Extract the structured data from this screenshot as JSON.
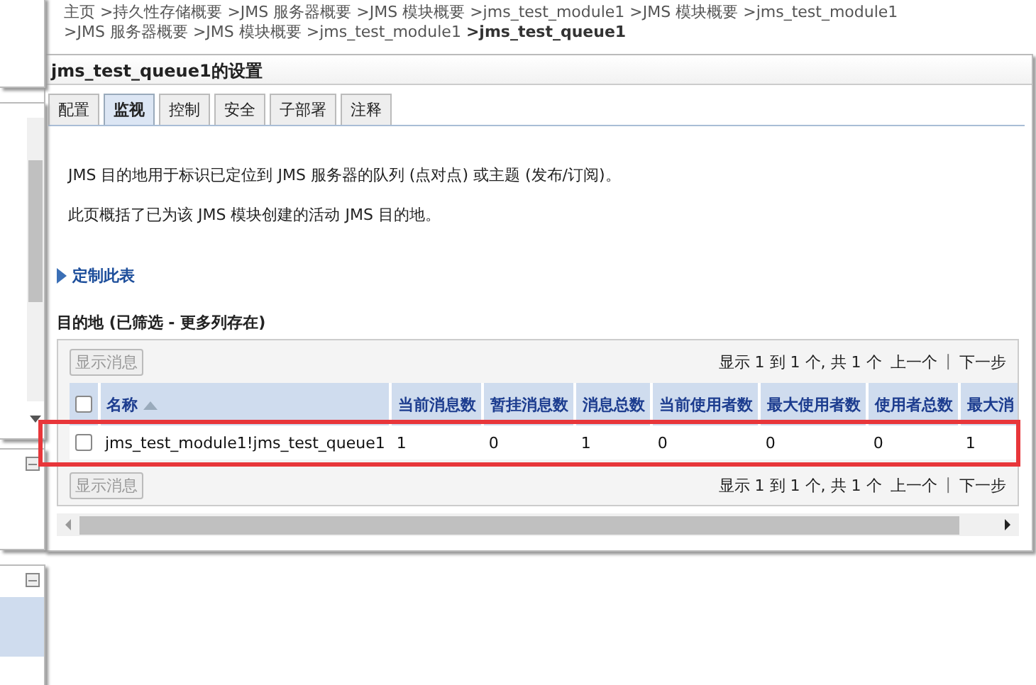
{
  "breadcrumb": [
    {
      "text": "主页",
      "current": false
    },
    {
      "text": ">持久性存储概要",
      "current": false
    },
    {
      "text": ">JMS 服务器概要",
      "current": false
    },
    {
      "text": ">JMS 模块概要",
      "current": false
    },
    {
      "text": ">jms_test_module1",
      "current": false
    },
    {
      "text": ">JMS 模块概要",
      "current": false
    },
    {
      "text": ">jms_test_module1",
      "current": false
    },
    {
      "text": ">JMS 服务器概要",
      "current": false
    },
    {
      "text": ">JMS 模块概要",
      "current": false
    },
    {
      "text": ">jms_test_module1",
      "current": false
    },
    {
      "text": ">jms_test_queue1",
      "current": true
    }
  ],
  "panel": {
    "title": "jms_test_queue1的设置",
    "tabs": [
      {
        "label": "配置",
        "selected": false
      },
      {
        "label": "监视",
        "selected": true
      },
      {
        "label": "控制",
        "selected": false
      },
      {
        "label": "安全",
        "selected": false
      },
      {
        "label": "子部署",
        "selected": false
      },
      {
        "label": "注释",
        "selected": false
      }
    ],
    "description": [
      "JMS 目的地用于标识已定位到 JMS 服务器的队列 (点对点) 或主题 (发布/订阅)。",
      "此页概括了已为该 JMS 模块创建的活动 JMS 目的地。"
    ],
    "customize_link": "定制此表",
    "table": {
      "title": "目的地 (已筛选 - 更多列存在)",
      "toolbar_button": "显示消息",
      "all_checked": false,
      "paging": {
        "summary": "显示 1 到 1 个, 共 1 个",
        "previous": "上一个",
        "separator": "|",
        "next": "下一步"
      },
      "columns": [
        {
          "label": "名称",
          "sorted": true
        },
        {
          "label": "当前消息数",
          "sorted": false
        },
        {
          "label": "暂挂消息数",
          "sorted": false
        },
        {
          "label": "消息总数",
          "sorted": false
        },
        {
          "label": "当前使用者数",
          "sorted": false
        },
        {
          "label": "最大使用者数",
          "sorted": false
        },
        {
          "label": "使用者总数",
          "sorted": false
        },
        {
          "label": "最大消",
          "sorted": false
        }
      ],
      "rows": [
        {
          "checked": false,
          "cells": [
            "jms_test_module1!jms_test_queue1",
            "1",
            "0",
            "1",
            "0",
            "0",
            "0",
            "1"
          ]
        }
      ],
      "bottom_button": "显示消息",
      "bottom_paging": {
        "summary": "显示 1 到 1 个, 共 1 个",
        "previous": "上一个",
        "separator": "|",
        "next": "下一步"
      }
    }
  }
}
